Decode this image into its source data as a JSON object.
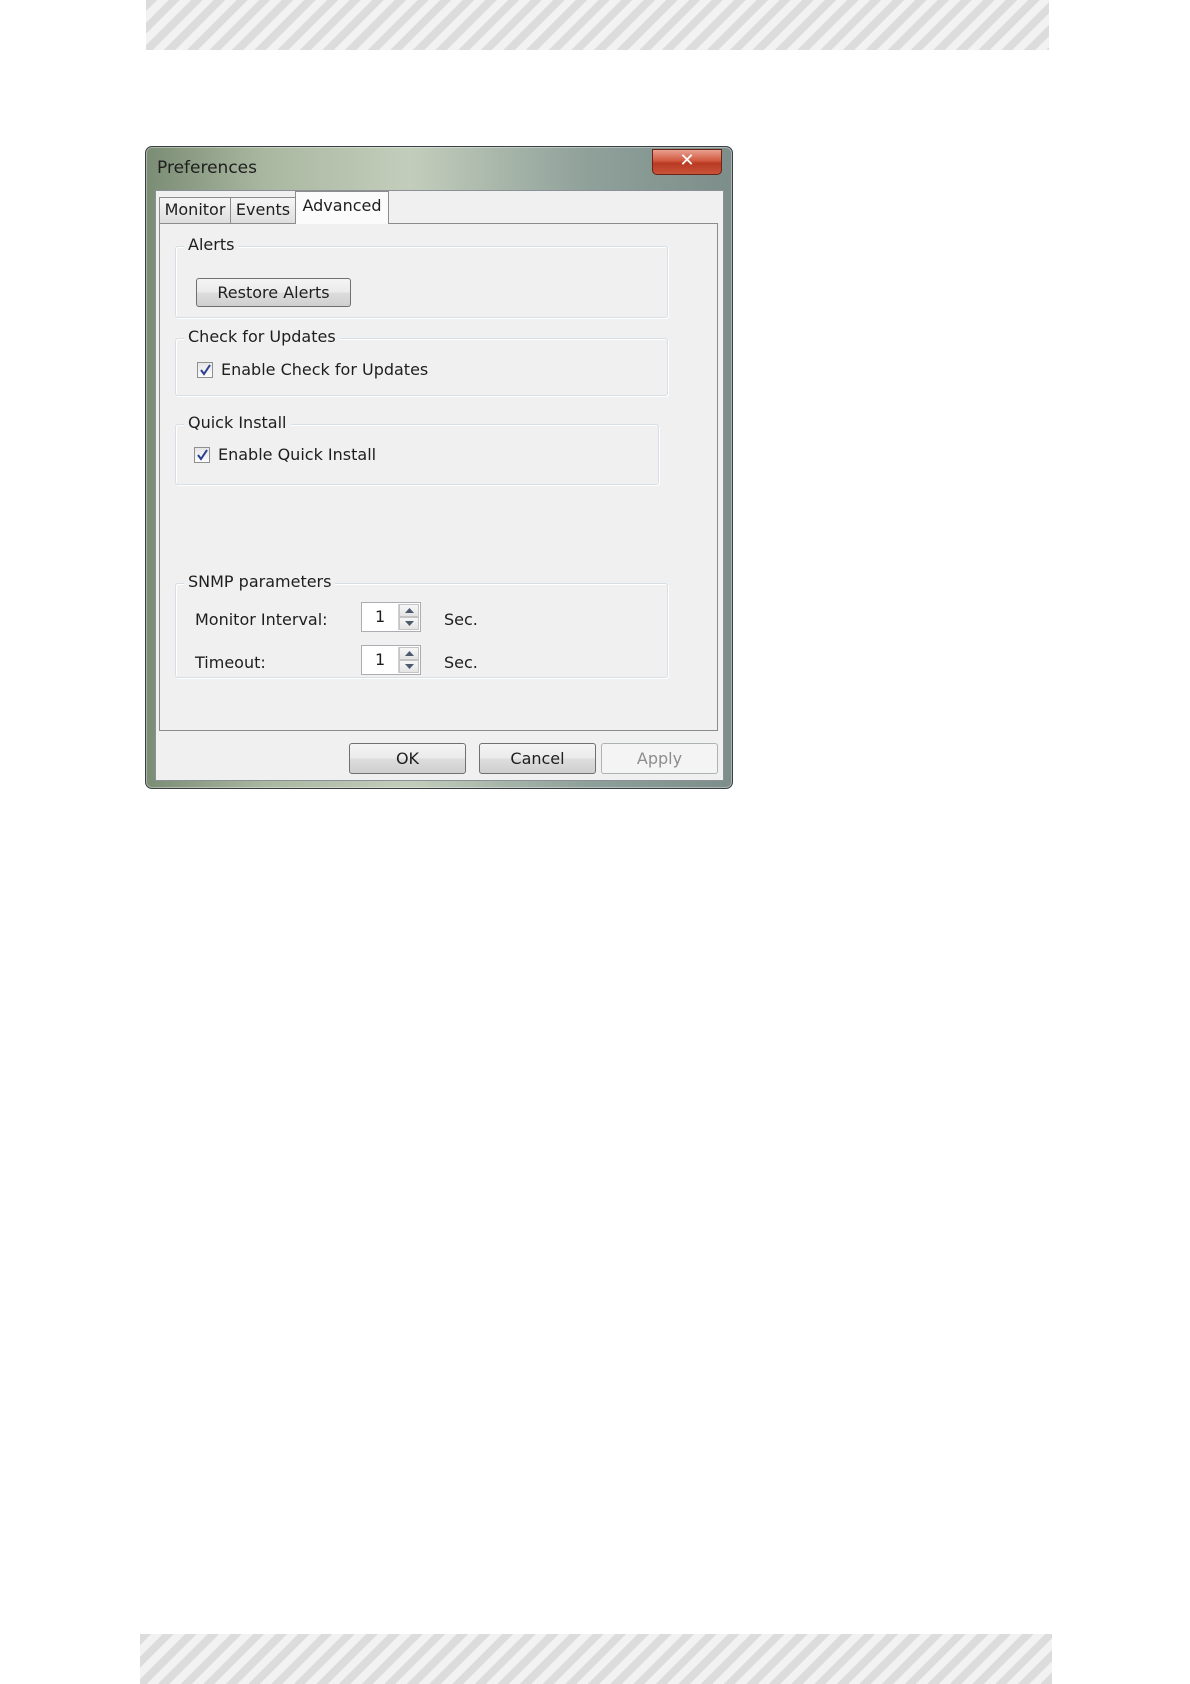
{
  "window": {
    "title": "Preferences",
    "close_glyph": "✕"
  },
  "tabs": [
    {
      "label": "Monitor",
      "selected": false
    },
    {
      "label": "Events",
      "selected": false
    },
    {
      "label": "Advanced",
      "selected": true
    }
  ],
  "alerts": {
    "group_label": "Alerts",
    "restore_button": "Restore Alerts"
  },
  "updates": {
    "group_label": "Check for Updates",
    "checkbox_label": "Enable Check for Updates",
    "checked": true
  },
  "quick_install": {
    "group_label": "Quick Install",
    "checkbox_label": "Enable Quick Install",
    "checked": true
  },
  "snmp": {
    "group_label": "SNMP parameters",
    "monitor_interval": {
      "label": "Monitor Interval:",
      "value": "1",
      "unit": "Sec."
    },
    "timeout": {
      "label": "Timeout:",
      "value": "1",
      "unit": "Sec."
    }
  },
  "footer": {
    "ok": "OK",
    "cancel": "Cancel",
    "apply": "Apply"
  },
  "colors": {
    "close_button": "#c9533a",
    "dialog_face": "#f0f0f0",
    "disabled_text": "#8d8d8d"
  },
  "icons": {
    "close": "close-icon",
    "check": "checkmark-icon",
    "spin_up": "arrow-up-icon",
    "spin_down": "arrow-down-icon"
  }
}
